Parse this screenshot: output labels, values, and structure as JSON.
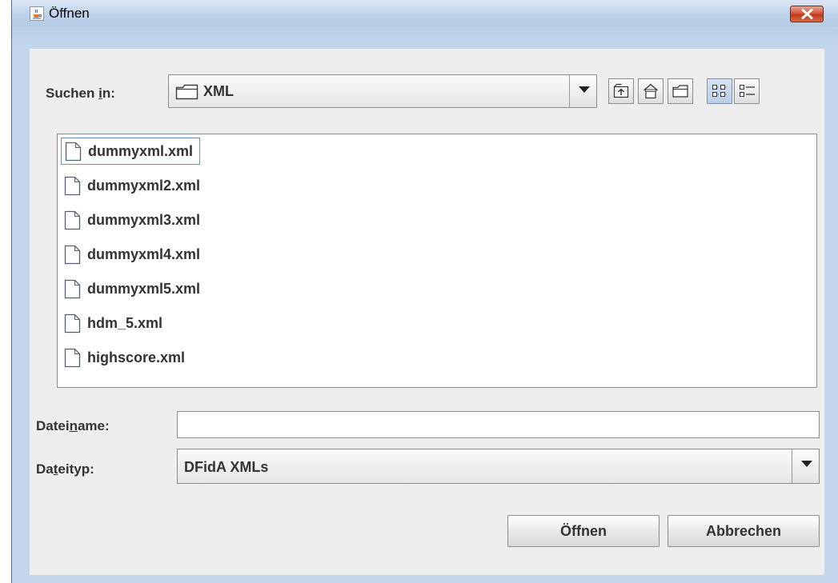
{
  "window": {
    "title": "Öffnen",
    "close_icon": "close-icon",
    "app_icon": "java-cup-icon"
  },
  "lookin": {
    "label_pre": "Suchen ",
    "label_mnemonic": "i",
    "label_post": "n:",
    "value": "XML",
    "folder_icon": "folder-icon"
  },
  "toolbar": {
    "buttons": [
      {
        "name": "up-one-level-icon"
      },
      {
        "name": "home-icon"
      },
      {
        "name": "new-folder-icon"
      },
      {
        "name": "list-view-icon",
        "active": true
      },
      {
        "name": "details-view-icon"
      }
    ]
  },
  "files": [
    {
      "name": "dummyxml.xml",
      "focused": true
    },
    {
      "name": "dummyxml2.xml"
    },
    {
      "name": "dummyxml3.xml"
    },
    {
      "name": "dummyxml4.xml"
    },
    {
      "name": "dummyxml5.xml"
    },
    {
      "name": "hdm_5.xml"
    },
    {
      "name": "highscore.xml"
    }
  ],
  "filename": {
    "label_pre": "Datei",
    "label_mnemonic": "n",
    "label_post": "ame:",
    "value": ""
  },
  "filetype": {
    "label_pre": "Da",
    "label_mnemonic": "t",
    "label_post": "eityp:",
    "value": "DFidA XMLs"
  },
  "buttons": {
    "open": "Öffnen",
    "cancel": "Abbrechen"
  }
}
